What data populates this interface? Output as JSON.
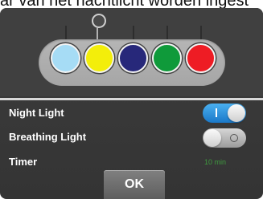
{
  "header": {
    "partial_text": "ar van het nachtlicht worden ingest"
  },
  "colors": {
    "accent": "#1a78c8",
    "timer_green": "#3f9a3f",
    "panel_bg": "#3a3a3a"
  },
  "color_picker": {
    "selected_index": 0,
    "swatches": [
      {
        "name": "light-blue",
        "hex": "#a6dcf5"
      },
      {
        "name": "yellow",
        "hex": "#f3ee0a"
      },
      {
        "name": "dark-blue",
        "hex": "#27287a"
      },
      {
        "name": "green",
        "hex": "#0f9a3a"
      },
      {
        "name": "red",
        "hex": "#ee1c24"
      }
    ]
  },
  "settings": {
    "night_light": {
      "label": "Night Light",
      "enabled": true
    },
    "breathing_light": {
      "label": "Breathing Light",
      "enabled": false
    },
    "timer": {
      "label": "Timer",
      "value": "10 min"
    }
  },
  "buttons": {
    "ok_label": "OK"
  },
  "icons": {
    "selector": "circle-selector-icon",
    "toggle_on": "toggle-on-icon",
    "toggle_off": "toggle-off-icon"
  }
}
